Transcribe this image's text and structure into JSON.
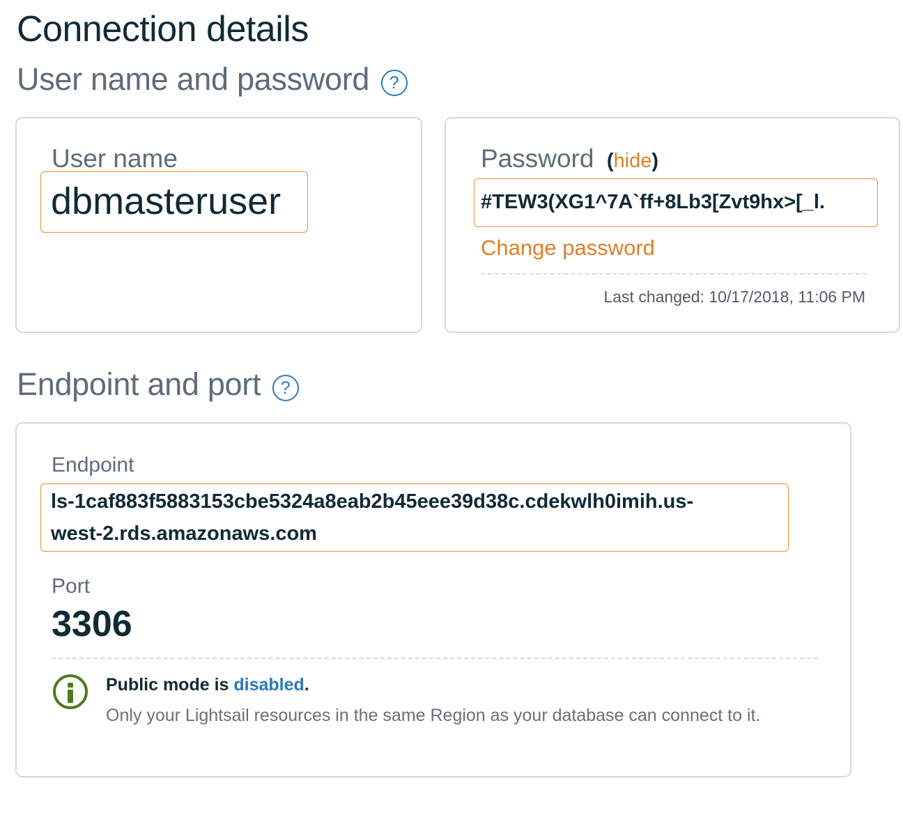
{
  "title": "Connection details",
  "credentials": {
    "heading": "User name and password",
    "help_glyph": "?",
    "username": {
      "label": "User name",
      "value": "dbmasteruser"
    },
    "password": {
      "label": "Password",
      "toggle_open": "(",
      "toggle_label": "hide",
      "toggle_close": ")",
      "value": "#TEW3(XG1^7A`ff+8Lb3[Zvt9hx>[_l.",
      "change_label": "Change password",
      "last_changed": "Last changed: 10/17/2018, 11:06 PM"
    }
  },
  "endpoint_section": {
    "heading": "Endpoint and port",
    "help_glyph": "?",
    "endpoint": {
      "label": "Endpoint",
      "line1": "ls-1caf883f5883153cbe5324a8eab2b45eee39d38c.cdekwlh0imih.us-",
      "line2": "west-2.rds.amazonaws.com"
    },
    "port": {
      "label": "Port",
      "value": "3306"
    },
    "public_mode": {
      "icon": "info-icon",
      "prefix": "Public mode is",
      "status": "disabled",
      "suffix": ".",
      "description": "Only your Lightsail resources in the same Region as your database can connect to it."
    }
  },
  "colors": {
    "accent": "#e07d27",
    "link": "#2a7ab8",
    "info": "#4e7a1f",
    "heading": "#102a36"
  }
}
